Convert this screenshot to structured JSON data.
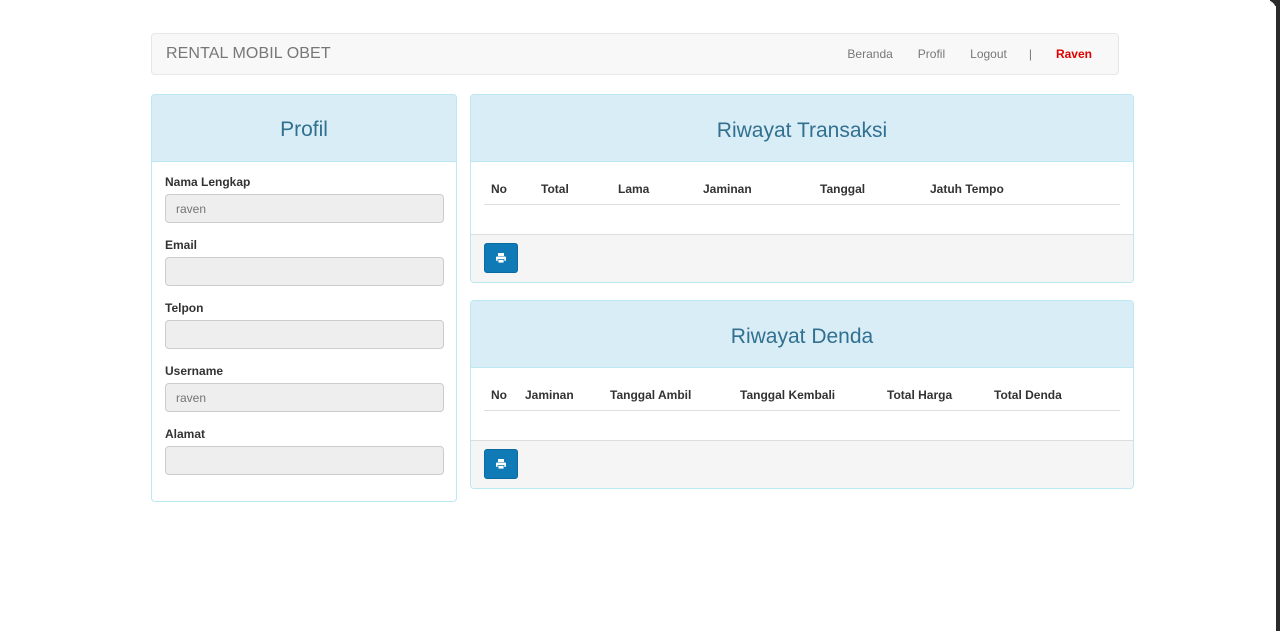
{
  "navbar": {
    "brand": "RENTAL MOBIL OBET",
    "links": [
      "Beranda",
      "Profil",
      "Logout"
    ],
    "separator": "|",
    "user": "Raven"
  },
  "profil": {
    "title": "Profil",
    "fields": [
      {
        "label": "Nama Lengkap",
        "value": ""
      },
      {
        "label": "Email",
        "value": ""
      },
      {
        "label": "Telpon",
        "value": ""
      },
      {
        "label": "Username",
        "value": ""
      },
      {
        "label": "Alamat",
        "value": ""
      }
    ],
    "placeholders": [
      "raven",
      "",
      "",
      "raven",
      ""
    ]
  },
  "transaksi": {
    "title": "Riwayat Transaksi",
    "columns": [
      "No",
      "Total",
      "Lama",
      "Jaminan",
      "Tanggal",
      "Jatuh Tempo"
    ],
    "print_icon": "print-icon"
  },
  "denda": {
    "title": "Riwayat Denda",
    "columns": [
      "No",
      "Jaminan",
      "Tanggal Ambil",
      "Tanggal Kembali",
      "Total Harga",
      "Total Denda"
    ],
    "print_icon": "print-icon"
  },
  "colors": {
    "accent": "#0f7ab5",
    "panel_heading_bg": "#d9edf7",
    "panel_heading_text": "#31708f",
    "user": "#e00000"
  }
}
